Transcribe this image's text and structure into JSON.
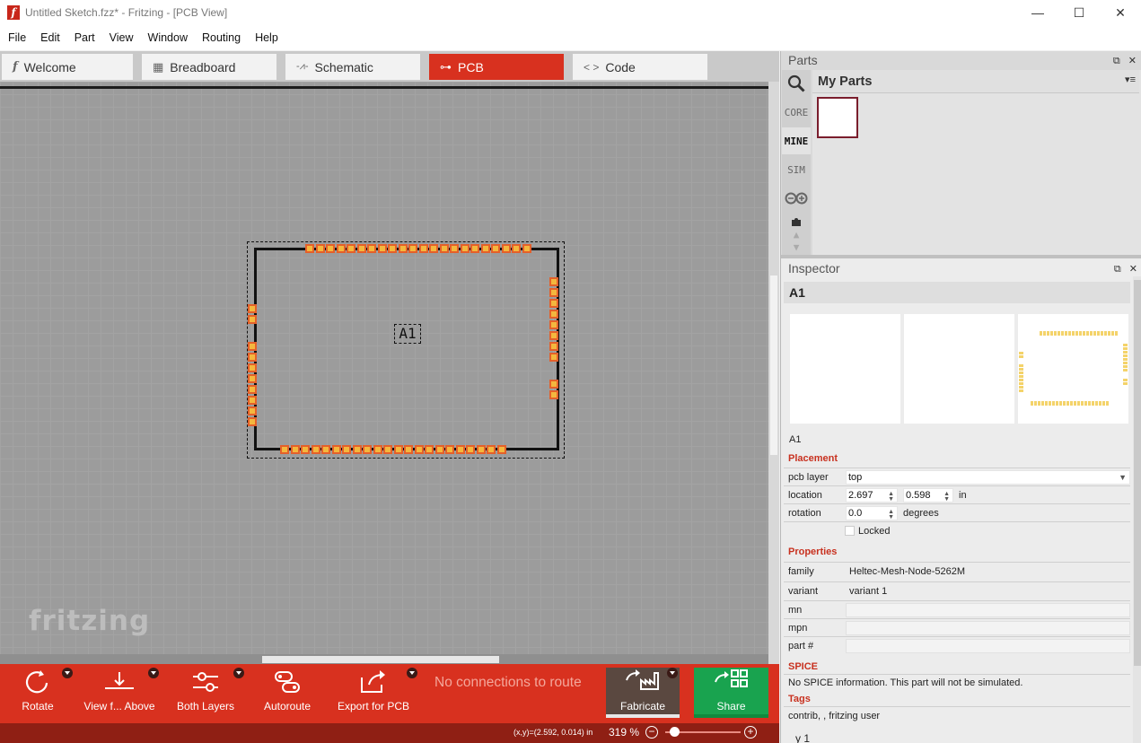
{
  "window": {
    "title": "Untitled Sketch.fzz* - Fritzing - [PCB View]",
    "app_icon": "f",
    "minimize": "—",
    "maximize": "☐",
    "close": "✕"
  },
  "menu": [
    "File",
    "Edit",
    "Part",
    "View",
    "Window",
    "Routing",
    "Help"
  ],
  "tabs": [
    {
      "label": "Welcome",
      "icon": "fritzing-f-icon",
      "glyph": "f"
    },
    {
      "label": "Breadboard",
      "icon": "breadboard-icon",
      "glyph": "▦"
    },
    {
      "label": "Schematic",
      "icon": "resistor-icon",
      "glyph": "-⩘-"
    },
    {
      "label": "PCB",
      "icon": "pcb-icon",
      "glyph": "⊶",
      "active": true
    },
    {
      "label": "Code",
      "icon": "code-brackets-icon",
      "glyph": "< >"
    }
  ],
  "canvas": {
    "part_label": "A1",
    "watermark": "fritzing"
  },
  "toolbar": {
    "rotate": "Rotate",
    "view_from": "View f... Above",
    "layers": "Both Layers",
    "autoroute": "Autoroute",
    "export": "Export for PCB",
    "status": "No connections to route",
    "fabricate": "Fabricate",
    "share": "Share"
  },
  "statusbar": {
    "coords": "(x,y)=(2.592, 0.014) in",
    "zoom": "319 %",
    "zoom_out": "−",
    "zoom_in": "+",
    "zoom_level": 0.1
  },
  "parts_panel": {
    "title": "Parts",
    "float_close": "⧉ ✕",
    "bins": [
      "CORE",
      "MINE",
      "SIM"
    ],
    "active_bin": "MINE",
    "bin_title": "My Parts",
    "bin_menu": "▾≡"
  },
  "inspector": {
    "title": "Inspector",
    "float_close": "⧉ ✕",
    "part_title": "A1",
    "part_instance": "A1",
    "placement": {
      "heading": "Placement",
      "pcb_layer_label": "pcb layer",
      "pcb_layer_value": "top",
      "location_label": "location",
      "location_x": "2.697",
      "location_y": "0.598",
      "location_unit": "in",
      "rotation_label": "rotation",
      "rotation_value": "0.0",
      "rotation_unit": "degrees",
      "locked_label": "Locked"
    },
    "properties": {
      "heading": "Properties",
      "rows": [
        {
          "label": "family",
          "value": "Heltec-Mesh-Node-5262M"
        },
        {
          "label": "variant",
          "value": "variant 1"
        },
        {
          "label": "mn",
          "value": ""
        },
        {
          "label": "mpn",
          "value": ""
        },
        {
          "label": "part #",
          "value": ""
        }
      ]
    },
    "spice": {
      "heading": "SPICE",
      "text": "No SPICE information. This part will not be simulated."
    },
    "tags": {
      "heading": "Tags",
      "text": "contrib, , fritzing user"
    },
    "connections_peek": "y 1"
  },
  "colors": {
    "accent_red": "#d8311f",
    "status_red": "#8f1f14",
    "share_green": "#19a34f",
    "fabricate_brown": "#5a4840",
    "pad_fill": "#f4b73e",
    "pad_ring": "#e4602a"
  }
}
